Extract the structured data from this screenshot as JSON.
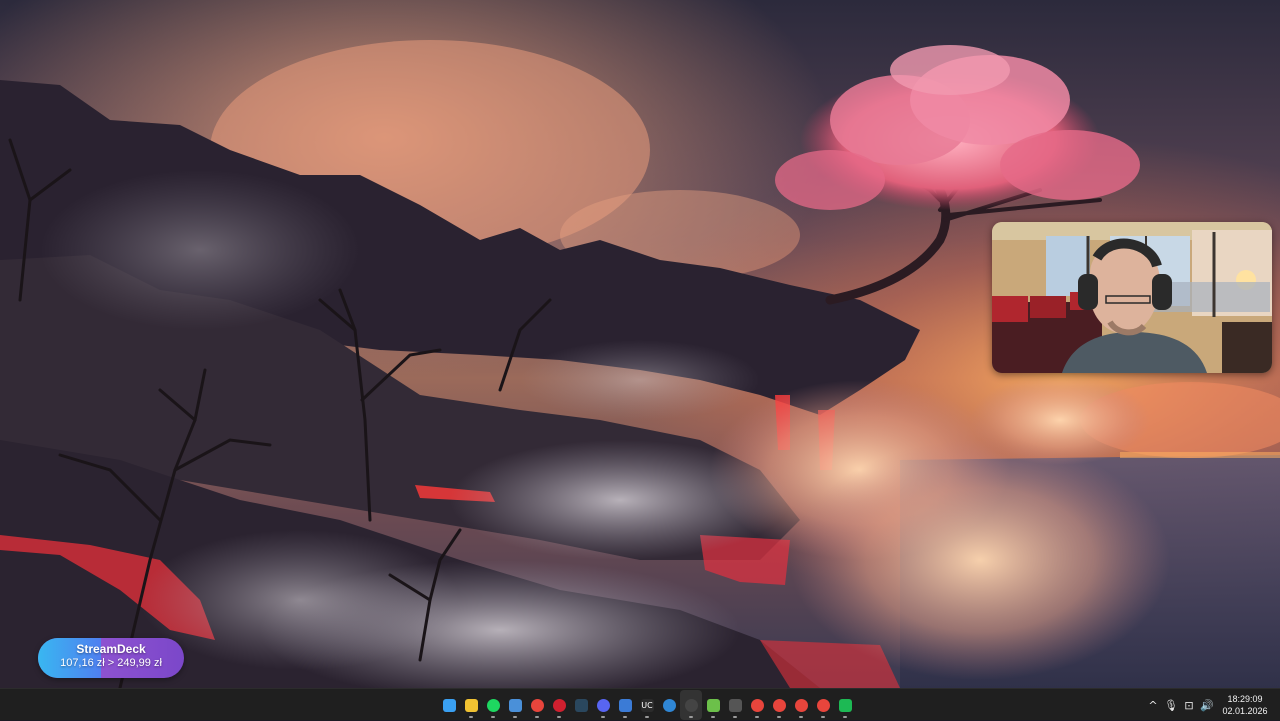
{
  "goal_widget": {
    "title": "StreamDeck",
    "progress_text": "107,16 zł > 249,99 zł",
    "progress_fraction": 0.43
  },
  "taskbar": {
    "apps": [
      {
        "name": "start-icon",
        "color": "#3aa0f2",
        "glyph": ""
      },
      {
        "name": "file-explorer-icon",
        "color": "#f1c232",
        "glyph": ""
      },
      {
        "name": "spotify-icon",
        "color": "#1ed760",
        "glyph": ""
      },
      {
        "name": "notepad-icon",
        "color": "#4a90d9",
        "glyph": ""
      },
      {
        "name": "chrome-icon",
        "color": "#e8453c",
        "glyph": ""
      },
      {
        "name": "red-app-icon",
        "color": "#d0202f",
        "glyph": ""
      },
      {
        "name": "steam-icon",
        "color": "#2a475e",
        "glyph": ""
      },
      {
        "name": "discord-icon",
        "color": "#5865f2",
        "glyph": ""
      },
      {
        "name": "phone-link-icon",
        "color": "#3b7bd6",
        "glyph": ""
      },
      {
        "name": "ubisoft-icon",
        "color": "#2b2b2b",
        "glyph": "UC"
      },
      {
        "name": "circle-app-icon",
        "color": "#2f86d4",
        "glyph": ""
      },
      {
        "name": "obs-icon",
        "color": "#444444",
        "glyph": ""
      },
      {
        "name": "green-app-icon",
        "color": "#6cc04a",
        "glyph": ""
      },
      {
        "name": "gear-app-icon",
        "color": "#555555",
        "glyph": ""
      },
      {
        "name": "chrome-profile-2-icon",
        "color": "#e8453c",
        "glyph": ""
      },
      {
        "name": "chrome-profile-3-icon",
        "color": "#e8453c",
        "glyph": ""
      },
      {
        "name": "chrome-profile-4-icon",
        "color": "#e8453c",
        "glyph": ""
      },
      {
        "name": "chrome-profile-5-icon",
        "color": "#e8453c",
        "glyph": ""
      },
      {
        "name": "media-play-icon",
        "color": "#1db954",
        "glyph": ""
      }
    ],
    "tray": {
      "chevron": "^",
      "microphone": "🎙",
      "network": "⊡",
      "volume": "🔊"
    },
    "clock": {
      "time": "18:29:09",
      "date": "02.01.2026"
    }
  }
}
